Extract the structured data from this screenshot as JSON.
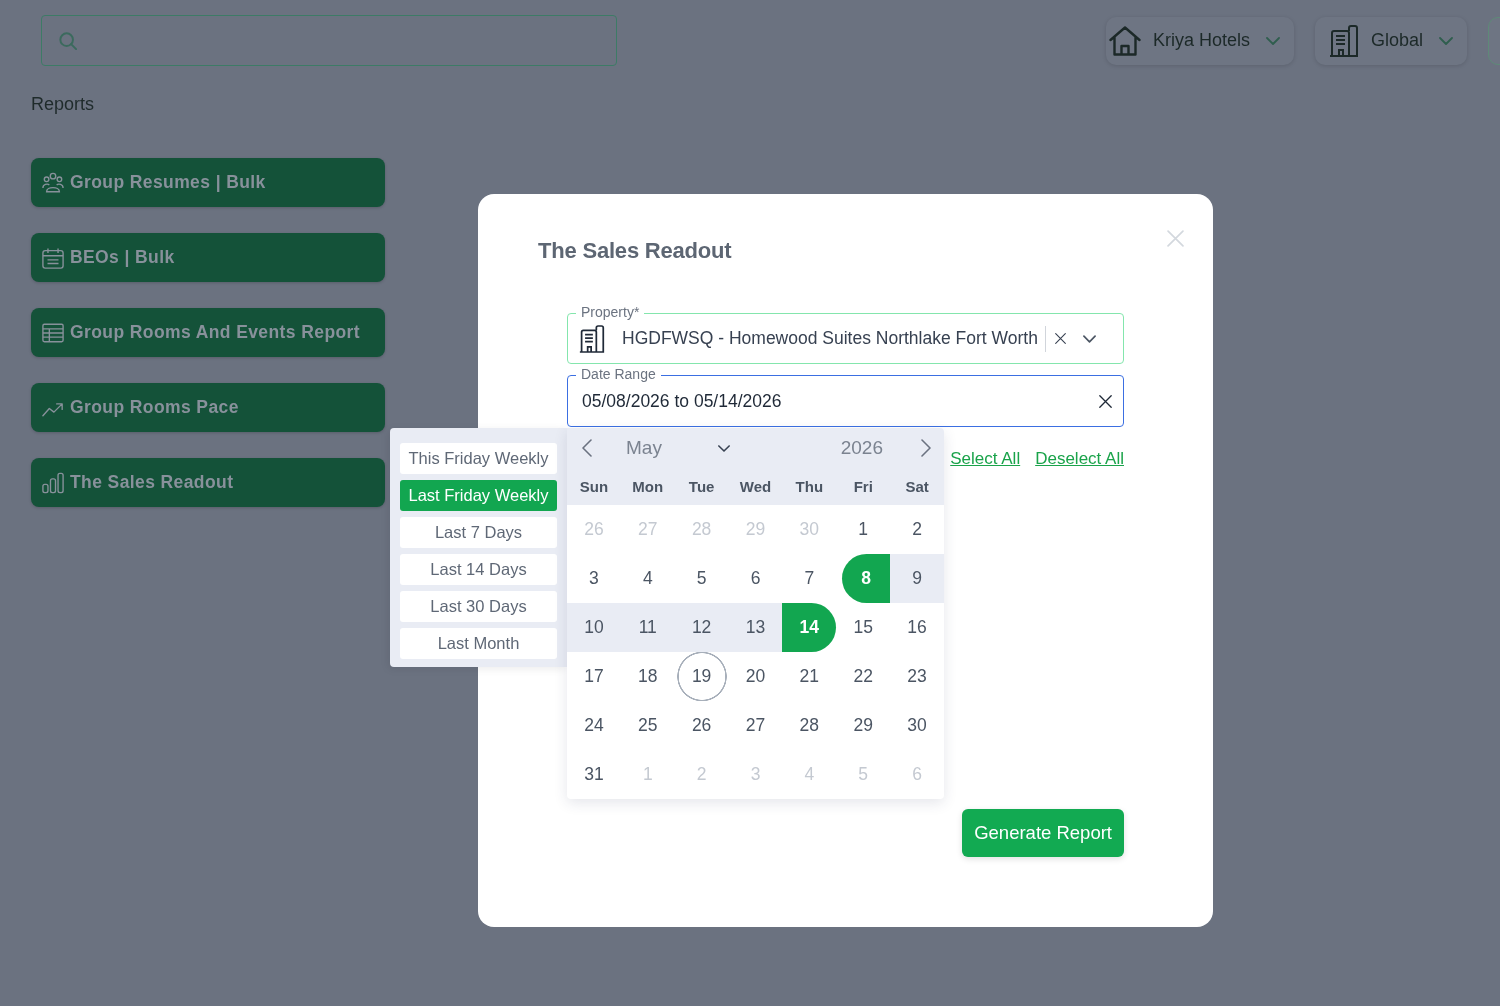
{
  "header": {
    "menus": [
      {
        "label": "Kriya Hotels"
      },
      {
        "label": "Global"
      }
    ]
  },
  "page_title": "Reports",
  "reports": [
    {
      "label": "Group Resumes | Bulk"
    },
    {
      "label": "BEOs | Bulk"
    },
    {
      "label": "Group Rooms And Events Report"
    },
    {
      "label": "Group Rooms Pace"
    },
    {
      "label": "The Sales Readout"
    }
  ],
  "modal": {
    "title": "The Sales Readout",
    "property": {
      "label": "Property*",
      "value": "HGDFWSQ - Homewood Suites Northlake Fort Worth",
      "focused": false
    },
    "date_range": {
      "label": "Date Range",
      "value": "05/08/2026 to 05/14/2026",
      "focused": true
    },
    "links": [
      "Select All",
      "Deselect All"
    ],
    "date_picker": {
      "presets": [
        {
          "label": "This Friday Weekly",
          "selected": false
        },
        {
          "label": "Last Friday Weekly",
          "selected": true
        },
        {
          "label": "Last 7 Days",
          "selected": false
        },
        {
          "label": "Last 14 Days",
          "selected": false
        },
        {
          "label": "Last 30 Days",
          "selected": false
        },
        {
          "label": "Last Month",
          "selected": false
        }
      ],
      "month": "May",
      "year": "2026",
      "weekdays": [
        "Sun",
        "Mon",
        "Tue",
        "Wed",
        "Thu",
        "Fri",
        "Sat"
      ],
      "weeks": [
        [
          {
            "day": "26",
            "outside": true,
            "in_range": false,
            "selected": false,
            "today": false
          },
          {
            "day": "27",
            "outside": true,
            "in_range": false,
            "selected": false,
            "today": false
          },
          {
            "day": "28",
            "outside": true,
            "in_range": false,
            "selected": false,
            "today": false
          },
          {
            "day": "29",
            "outside": true,
            "in_range": false,
            "selected": false,
            "today": false
          },
          {
            "day": "30",
            "outside": true,
            "in_range": false,
            "selected": false,
            "today": false
          },
          {
            "day": "1",
            "outside": false,
            "in_range": false,
            "selected": false,
            "today": false
          },
          {
            "day": "2",
            "outside": false,
            "in_range": false,
            "selected": false,
            "today": false
          }
        ],
        [
          {
            "day": "3",
            "outside": false,
            "in_range": false,
            "selected": false,
            "today": false
          },
          {
            "day": "4",
            "outside": false,
            "in_range": false,
            "selected": false,
            "today": false
          },
          {
            "day": "5",
            "outside": false,
            "in_range": false,
            "selected": false,
            "today": false
          },
          {
            "day": "6",
            "outside": false,
            "in_range": false,
            "selected": false,
            "today": false
          },
          {
            "day": "7",
            "outside": false,
            "in_range": false,
            "selected": false,
            "today": false
          },
          {
            "day": "8",
            "outside": false,
            "in_range": false,
            "selected": true,
            "today": false
          },
          {
            "day": "9",
            "outside": false,
            "in_range": true,
            "selected": false,
            "today": false
          }
        ],
        [
          {
            "day": "10",
            "outside": false,
            "in_range": true,
            "selected": false,
            "today": false
          },
          {
            "day": "11",
            "outside": false,
            "in_range": true,
            "selected": false,
            "today": false
          },
          {
            "day": "12",
            "outside": false,
            "in_range": true,
            "selected": false,
            "today": false
          },
          {
            "day": "13",
            "outside": false,
            "in_range": true,
            "selected": false,
            "today": false
          },
          {
            "day": "14",
            "outside": false,
            "in_range": false,
            "selected": true,
            "today": false
          },
          {
            "day": "15",
            "outside": false,
            "in_range": false,
            "selected": false,
            "today": false
          },
          {
            "day": "16",
            "outside": false,
            "in_range": false,
            "selected": false,
            "today": false
          }
        ],
        [
          {
            "day": "17",
            "outside": false,
            "in_range": false,
            "selected": false,
            "today": false
          },
          {
            "day": "18",
            "outside": false,
            "in_range": false,
            "selected": false,
            "today": false
          },
          {
            "day": "19",
            "outside": false,
            "in_range": false,
            "selected": false,
            "today": true
          },
          {
            "day": "20",
            "outside": false,
            "in_range": false,
            "selected": false,
            "today": false
          },
          {
            "day": "21",
            "outside": false,
            "in_range": false,
            "selected": false,
            "today": false
          },
          {
            "day": "22",
            "outside": false,
            "in_range": false,
            "selected": false,
            "today": false
          },
          {
            "day": "23",
            "outside": false,
            "in_range": false,
            "selected": false,
            "today": false
          }
        ],
        [
          {
            "day": "24",
            "outside": false,
            "in_range": false,
            "selected": false,
            "today": false
          },
          {
            "day": "25",
            "outside": false,
            "in_range": false,
            "selected": false,
            "today": false
          },
          {
            "day": "26",
            "outside": false,
            "in_range": false,
            "selected": false,
            "today": false
          },
          {
            "day": "27",
            "outside": false,
            "in_range": false,
            "selected": false,
            "today": false
          },
          {
            "day": "28",
            "outside": false,
            "in_range": false,
            "selected": false,
            "today": false
          },
          {
            "day": "29",
            "outside": false,
            "in_range": false,
            "selected": false,
            "today": false
          },
          {
            "day": "30",
            "outside": false,
            "in_range": false,
            "selected": false,
            "today": false
          }
        ],
        [
          {
            "day": "31",
            "outside": false,
            "in_range": false,
            "selected": false,
            "today": false
          },
          {
            "day": "1",
            "outside": true,
            "in_range": false,
            "selected": false,
            "today": false
          },
          {
            "day": "2",
            "outside": true,
            "in_range": false,
            "selected": false,
            "today": false
          },
          {
            "day": "3",
            "outside": true,
            "in_range": false,
            "selected": false,
            "today": false
          },
          {
            "day": "4",
            "outside": true,
            "in_range": false,
            "selected": false,
            "today": false
          },
          {
            "day": "5",
            "outside": true,
            "in_range": false,
            "selected": false,
            "today": false
          },
          {
            "day": "6",
            "outside": true,
            "in_range": false,
            "selected": false,
            "today": false
          }
        ]
      ]
    },
    "submit": "Generate Report"
  }
}
